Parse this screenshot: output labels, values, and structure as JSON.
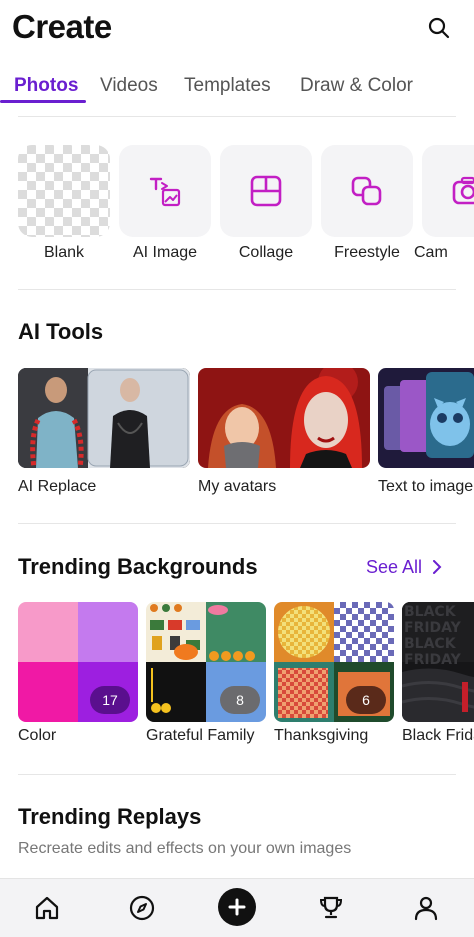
{
  "header": {
    "title": "Create"
  },
  "tabs": [
    {
      "label": "Photos",
      "active": true
    },
    {
      "label": "Videos",
      "active": false
    },
    {
      "label": "Templates",
      "active": false
    },
    {
      "label": "Draw & Color",
      "active": false
    }
  ],
  "create_items": [
    {
      "label": "Blank",
      "icon": "transparent-checker"
    },
    {
      "label": "AI Image",
      "icon": "text-to-image-icon"
    },
    {
      "label": "Collage",
      "icon": "collage-icon"
    },
    {
      "label": "Freestyle",
      "icon": "freestyle-icon"
    },
    {
      "label": "Cam",
      "icon": "camera-icon"
    }
  ],
  "ai_tools": {
    "title": "AI Tools",
    "items": [
      {
        "label": "AI Replace"
      },
      {
        "label": "My avatars"
      },
      {
        "label": "Text to image"
      }
    ]
  },
  "trending_backgrounds": {
    "title": "Trending Backgrounds",
    "see_all": "See All",
    "items": [
      {
        "label": "Color",
        "count": "17"
      },
      {
        "label": "Grateful Family",
        "count": "8"
      },
      {
        "label": "Thanksgiving",
        "count": "6"
      },
      {
        "label": "Black Friday",
        "count": "",
        "image_text": "BLACK FRIDAY"
      }
    ]
  },
  "trending_replays": {
    "title": "Trending Replays",
    "subtitle": "Recreate edits and effects on your own images"
  },
  "bottom_nav": [
    "home-icon",
    "explore-icon",
    "plus-icon",
    "trophy-icon",
    "profile-icon"
  ],
  "colors": {
    "accent": "#6a1fd0",
    "icon_magenta": "#c21fc4"
  }
}
